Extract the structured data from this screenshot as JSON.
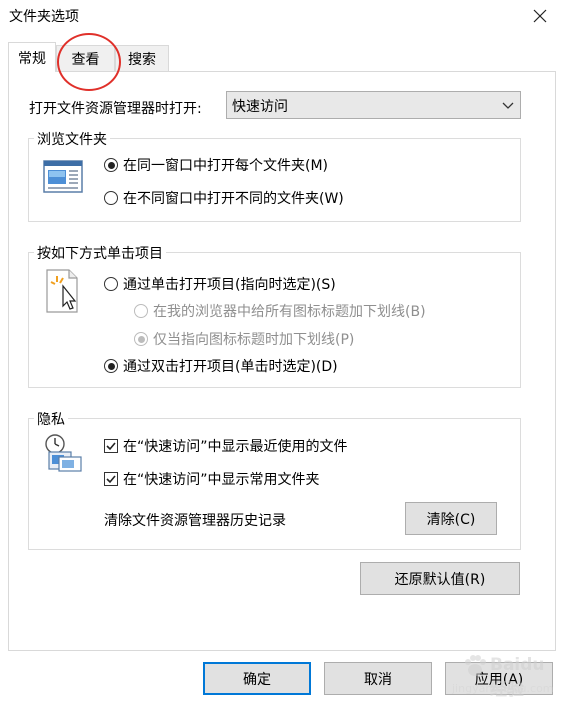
{
  "window": {
    "title": "文件夹选项"
  },
  "tabs": [
    {
      "label": "常规",
      "active": true
    },
    {
      "label": "查看",
      "active": false
    },
    {
      "label": "搜索",
      "active": false
    }
  ],
  "general": {
    "open_label": "打开文件资源管理器时打开:",
    "open_value": "快速访问",
    "browse_group": {
      "title": "浏览文件夹",
      "options": [
        {
          "label": "在同一窗口中打开每个文件夹(M)",
          "checked": true
        },
        {
          "label": "在不同窗口中打开不同的文件夹(W)",
          "checked": false
        }
      ]
    },
    "click_group": {
      "title": "按如下方式单击项目",
      "single_click": {
        "label": "通过单击打开项目(指向时选定)(S)",
        "checked": false
      },
      "underline_all": {
        "label": "在我的浏览器中给所有图标标题加下划线(B)",
        "checked": false
      },
      "underline_hover": {
        "label": "仅当指向图标标题时加下划线(P)",
        "checked": true
      },
      "double_click": {
        "label": "通过双击打开项目(单击时选定)(D)",
        "checked": true
      }
    },
    "privacy_group": {
      "title": "隐私",
      "recent_files": {
        "label": "在“快速访问”中显示最近使用的文件",
        "checked": true
      },
      "frequent_folders": {
        "label": "在“快速访问”中显示常用文件夹",
        "checked": true
      },
      "clear_label": "清除文件资源管理器历史记录",
      "clear_button": "清除(C)"
    },
    "restore_button": "还原默认值(R)"
  },
  "footer": {
    "ok": "确定",
    "cancel": "取消",
    "apply": "应用(A)"
  },
  "watermark": {
    "text": "Baidu 经验",
    "url": "jingyan.baidu.com"
  },
  "colors": {
    "accent": "#0078d7",
    "annotation_circle": "#e0302a"
  }
}
